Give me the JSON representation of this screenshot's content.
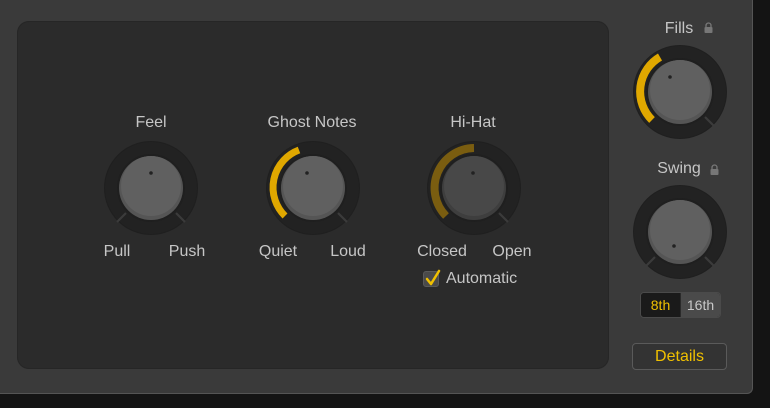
{
  "accent_color": "#e0a800",
  "feel": {
    "title": "Feel",
    "min_label": "Pull",
    "max_label": "Push",
    "value": 0.5
  },
  "ghost_notes": {
    "title": "Ghost Notes",
    "min_label": "Quiet",
    "max_label": "Loud",
    "value": 0.45
  },
  "hihat": {
    "title": "Hi-Hat",
    "min_label": "Closed",
    "max_label": "Open",
    "value": 0.45,
    "automatic_label": "Automatic",
    "automatic_checked": true
  },
  "fills": {
    "title": "Fills",
    "value": 0.42,
    "locked": true
  },
  "swing": {
    "title": "Swing",
    "value": 0.5,
    "locked": true,
    "options": [
      "8th",
      "16th"
    ],
    "selected": "8th"
  },
  "details_label": "Details"
}
